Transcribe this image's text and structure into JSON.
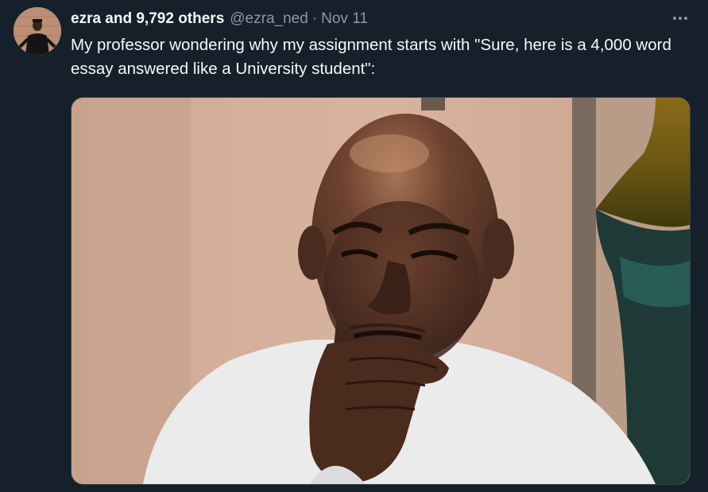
{
  "tweet": {
    "display_name": "ezra and 9,792 others",
    "handle": "@ezra_ned",
    "separator": "·",
    "timestamp": "Nov 11",
    "more_icon": "more-horizontal-icon",
    "text": "My professor wondering why my assignment starts with \"Sure, here is a 4,000 word essay answered like a University student\":",
    "media": {
      "kind": "photo",
      "alt_subject": "bald man in white t-shirt with hand on chin, skeptical expression"
    }
  },
  "colors": {
    "background": "#15202b",
    "primary_text": "#f7f9f9",
    "secondary_text": "#8b98a5",
    "border": "#38444d"
  }
}
